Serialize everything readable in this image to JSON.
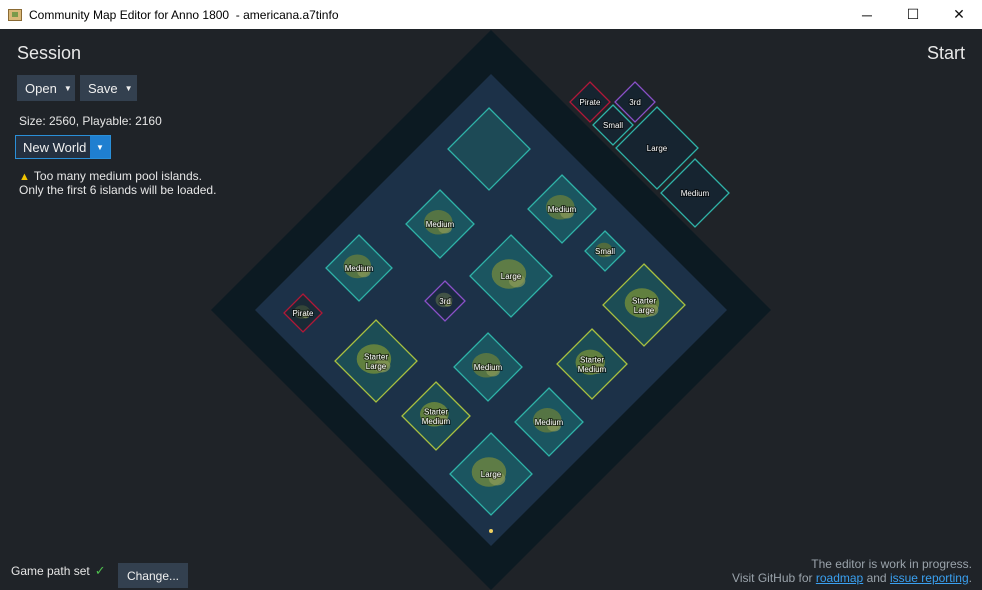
{
  "window": {
    "title": "Community Map Editor for Anno 1800  - americana.a7tinfo",
    "minimize_glyph": "─",
    "maximize_glyph": "☐",
    "close_glyph": "✕"
  },
  "left_panel": {
    "heading": "Session",
    "open_label": "Open",
    "save_label": "Save",
    "size_text": "Size: 2560, Playable: 2160",
    "world_select": "New World",
    "warning_line1": "Too many medium pool islands.",
    "warning_line2": "Only the first 6 islands will be loaded."
  },
  "right_panel": {
    "heading": "Start"
  },
  "footer": {
    "game_path_text": "Game path set",
    "change_label": "Change...",
    "note_line1": "The editor is work in progress.",
    "note_prefix": "Visit GitHub for ",
    "roadmap_link": "roadmap",
    "and_text": " and ",
    "issue_link": "issue reporting",
    "period": "."
  },
  "colors": {
    "accent_blue": "#1f7fd0",
    "medium_teal": "#2fb3a8",
    "starter_green": "#a8c040",
    "pirate_red": "#b01838",
    "third_purple": "#8a50c8",
    "playable_area": "#1c3148",
    "outer_border": "#0c1a22"
  },
  "map_islands": [
    {
      "label": "",
      "kind": "empty-large"
    },
    {
      "label": "Medium",
      "kind": "medium"
    },
    {
      "label": "Medium",
      "kind": "medium"
    },
    {
      "label": "Medium",
      "kind": "medium"
    },
    {
      "label": "Large",
      "kind": "large"
    },
    {
      "label": "Small",
      "kind": "small"
    },
    {
      "label": "Pirate",
      "kind": "pirate"
    },
    {
      "label": "3rd",
      "kind": "third"
    },
    {
      "label": "Starter Large",
      "kind": "starter"
    },
    {
      "label": "Starter Large",
      "kind": "starter"
    },
    {
      "label": "Medium",
      "kind": "medium"
    },
    {
      "label": "Starter Medium",
      "kind": "starter"
    },
    {
      "label": "Starter Medium",
      "kind": "starter"
    },
    {
      "label": "Medium",
      "kind": "medium"
    },
    {
      "label": "Large",
      "kind": "large"
    }
  ],
  "palette_islands": [
    {
      "label": "Pirate",
      "kind": "pirate"
    },
    {
      "label": "3rd",
      "kind": "third"
    },
    {
      "label": "Small",
      "kind": "small"
    },
    {
      "label": "Large",
      "kind": "large"
    },
    {
      "label": "Medium",
      "kind": "medium"
    }
  ]
}
